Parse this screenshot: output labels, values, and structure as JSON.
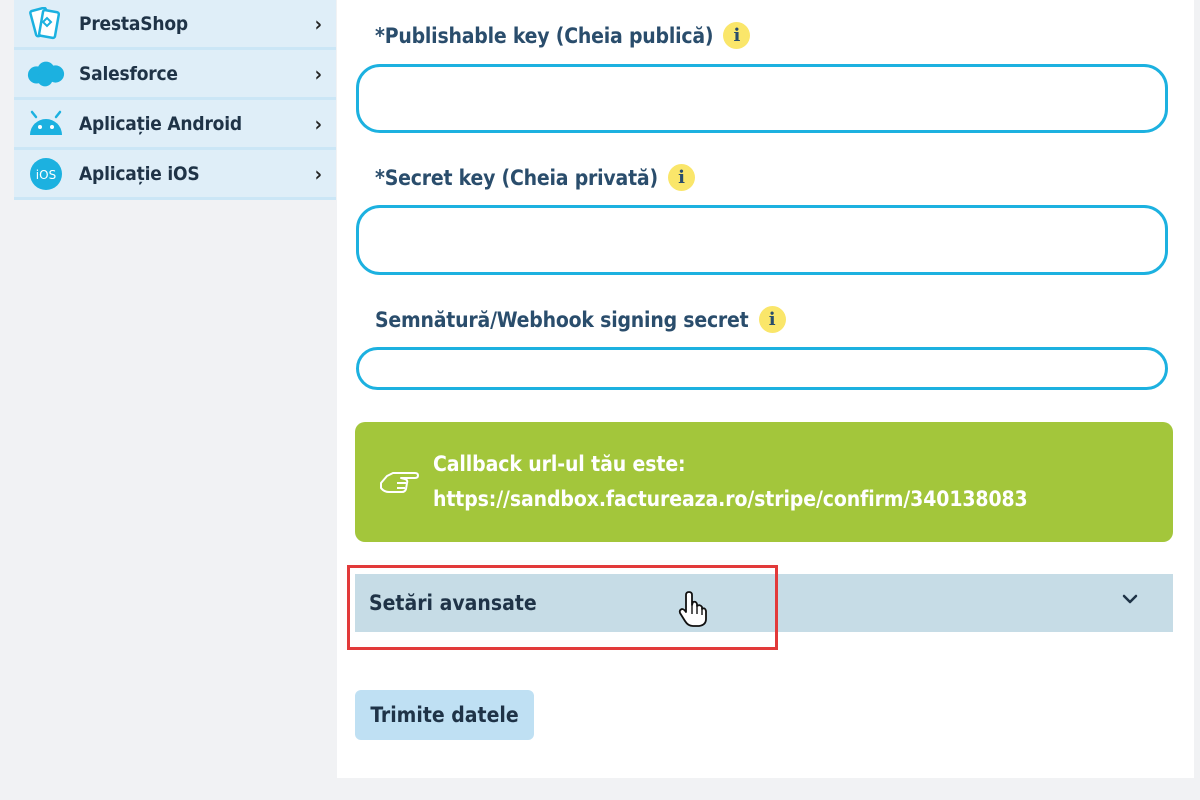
{
  "sidebar": {
    "items": [
      {
        "label": "PrestaShop",
        "icon": "prestashop-icon"
      },
      {
        "label": "Salesforce",
        "icon": "salesforce-icon"
      },
      {
        "label": "Aplicație Android",
        "icon": "android-icon"
      },
      {
        "label": "Aplicație iOS",
        "icon": "ios-icon",
        "icon_text": "iOS"
      }
    ],
    "chevron": "›"
  },
  "form": {
    "publishable_key": {
      "label": "Publishable key (Cheia publică)",
      "required_mark": "*",
      "value": ""
    },
    "secret_key": {
      "label": "Secret key (Cheia privată)",
      "required_mark": "*",
      "value": ""
    },
    "webhook_secret": {
      "label": "Semnătură/Webhook signing secret",
      "value": ""
    },
    "info_glyph": "i",
    "callback": {
      "line1": "Callback url-ul tău este:",
      "line2": "https://sandbox.factureaza.ro/stripe/confirm/340138083"
    },
    "advanced_settings": {
      "label": "Setări avansate"
    },
    "submit_label": "Trimite datele"
  },
  "colors": {
    "accent_input_border": "#1cb1e0",
    "callback_bg": "#a3c63b",
    "info_icon_bg": "#fae66a",
    "highlight_border": "#e23a3a"
  }
}
